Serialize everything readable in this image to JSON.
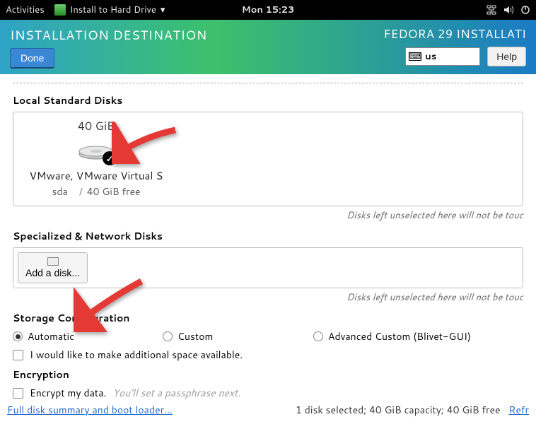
{
  "topbar": {
    "activities": "Activities",
    "app_name": "Install to Hard Drive",
    "clock": "Mon 15:23"
  },
  "header": {
    "title": "INSTALLATION DESTINATION",
    "done": "Done",
    "product": "FEDORA 29 INSTALLATI",
    "keyboard": "us",
    "help": "Help"
  },
  "sections": {
    "local_disks": "Local Standard Disks",
    "net_disks": "Specialized & Network Disks",
    "storage_cfg": "Storage Configuration",
    "encryption": "Encryption"
  },
  "disk": {
    "size": "40 GiB",
    "name": "VMware, VMware Virtual S",
    "device": "sda",
    "free": "40 GiB free"
  },
  "hints": {
    "unselected": "Disks left unselected here will not be touc"
  },
  "buttons": {
    "add_disk": "Add a disk..."
  },
  "storage": {
    "automatic": "Automatic",
    "custom": "Custom",
    "advanced": "Advanced Custom (Blivet-GUI)",
    "make_space": "I would like to make additional space available."
  },
  "encryption_opts": {
    "encrypt": "Encrypt my data.",
    "passphrase_hint": "You'll set a passphrase next."
  },
  "footer": {
    "summary_link": "Full disk summary and boot loader...",
    "status": "1 disk selected; 40 GiB capacity; 40 GiB free",
    "refresh": "Refr"
  }
}
